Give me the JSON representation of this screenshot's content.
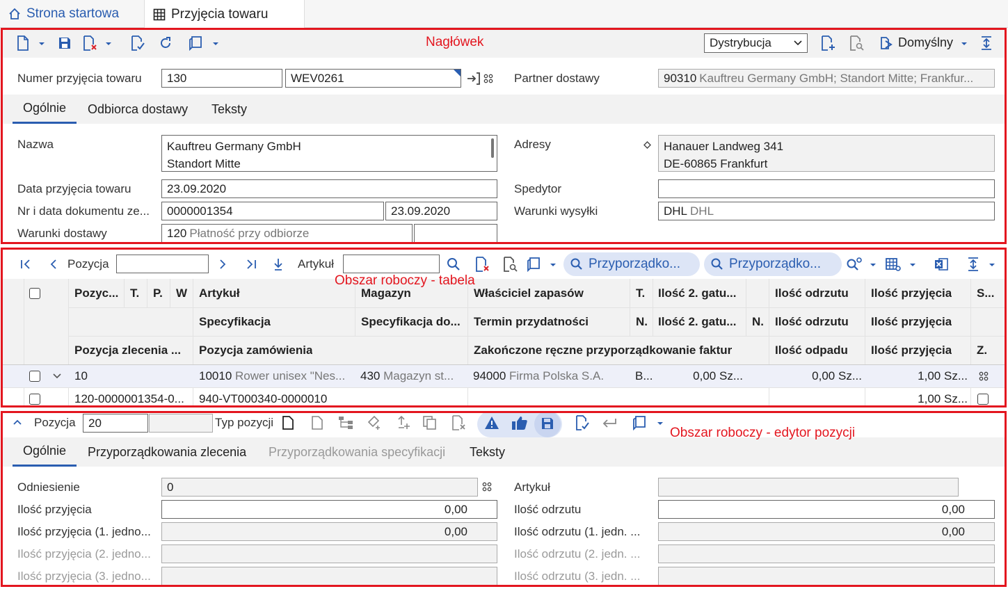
{
  "tabs": {
    "home": "Strona startowa",
    "active": "Przyjęcia towaru"
  },
  "annotations": {
    "header": "Nagłówek",
    "table": "Obszar roboczy - tabela",
    "editor": "Obszar roboczy - edytor pozycji"
  },
  "header": {
    "view_select": "Dystrybucja",
    "layout_label": "Domyślny",
    "number_label": "Numer przyjęcia towaru",
    "number_value": "130",
    "number_code": "WEV0261",
    "partner_label": "Partner dostawy",
    "partner_code": "90310",
    "partner_name": "Kauftreu Germany GmbH; Standort Mitte; Frankfur...",
    "tabs": [
      "Ogólnie",
      "Odbiorca dostawy",
      "Teksty"
    ],
    "name_label": "Nazwa",
    "name_line1": "Kauftreu Germany GmbH",
    "name_line2": "Standort Mitte",
    "address_label": "Adresy",
    "address_line1": "Hanauer Landweg 341",
    "address_line2": "DE-60865 Frankfurt",
    "date_label": "Data przyjęcia towaru",
    "date_value": "23.09.2020",
    "forwarder_label": "Spedytor",
    "forwarder_value": "",
    "docno_label": "Nr i data dokumentu ze...",
    "docno_value": "0000001354",
    "docdate_value": "23.09.2020",
    "shipping_label": "Warunki wysyłki",
    "shipping_code": "DHL",
    "shipping_name": "DHL",
    "delivery_label": "Warunki dostawy",
    "delivery_code": "120",
    "delivery_name": "Płatność przy odbiorze"
  },
  "table": {
    "pos_label": "Pozycja",
    "article_label": "Artykuł",
    "pill1": "Przyporządko...",
    "pill2": "Przyporządko...",
    "headers_row1": [
      "Pozyc...",
      "T.",
      "P.",
      "W",
      "Artykuł",
      "Magazyn",
      "Właściciel zapasów",
      "T.",
      "Ilość 2. gatu...",
      "Ilość odrzutu",
      "Ilość przyjęcia",
      "S..."
    ],
    "headers_row2": [
      "Specyfikacja",
      "Specyfikacja do...",
      "Termin przydatności",
      "N.",
      "Ilość 2. gatu...",
      "N.",
      "Ilość odrzutu",
      "Ilość przyjęcia"
    ],
    "headers_row3": [
      "Pozycja zlecenia ...",
      "Pozycja zamówienia",
      "Zakończone ręczne przyporządkowanie faktur",
      "Ilość odpadu",
      "Ilość przyjęcia",
      "Z."
    ],
    "row1": {
      "pos": "10",
      "article_code": "10010",
      "article_name": "Rower unisex \"Nes...",
      "warehouse_code": "430",
      "warehouse_name": "Magazyn st...",
      "owner_code": "94000",
      "owner_name": "Firma Polska S.A.",
      "t": "B...",
      "qty2": "0,00 Sz...",
      "reject": "0,00 Sz...",
      "receipt": "1,00 Sz..."
    },
    "row1b": {
      "order_pos": "120-0000001354-0...",
      "purchase_pos": "940-VT000340-0000010",
      "receipt": "1,00 Sz..."
    }
  },
  "editor": {
    "pos_label": "Pozycja",
    "pos_value": "20",
    "type_label": "Typ pozycji",
    "tabs": [
      "Ogólnie",
      "Przyporządkowania zlecenia",
      "Przyporządkowania specyfikacji",
      "Teksty"
    ],
    "ref_label": "Odniesienie",
    "ref_value": "0",
    "article_label": "Artykuł",
    "qty_label": "Ilość przyjęcia",
    "qty_value": "0,00",
    "reject_label": "Ilość odrzutu",
    "reject_value": "0,00",
    "qty1_label": "Ilość przyjęcia (1. jedno...",
    "qty1_value": "0,00",
    "reject1_label": "Ilość odrzutu (1. jedn. ...",
    "reject1_value": "0,00",
    "qty2_label": "Ilość przyjęcia (2. jedno...",
    "reject2_label": "Ilość odrzutu (2. jedn. ...",
    "qty3_label": "Ilość przyjęcia (3. jedno...",
    "reject3_label": "Ilość odrzutu (3. jedn. ..."
  }
}
